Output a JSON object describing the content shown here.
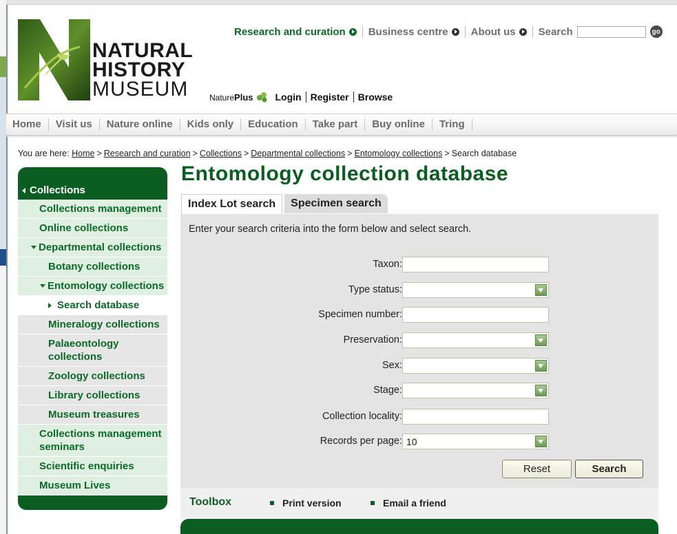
{
  "logo": {
    "line1": "NATURAL",
    "line2": "HISTORY",
    "line3": "MUSEUM"
  },
  "utilnav": {
    "items": [
      "Research and curation",
      "Business centre",
      "About us"
    ],
    "search_label": "Search",
    "search_placeholder": "",
    "go_label": "go"
  },
  "natureplus": {
    "brand_prefix": "Nature",
    "brand_bold": "Plus",
    "login": "Login",
    "register": "Register",
    "browse": "Browse"
  },
  "mainnav": [
    "Home",
    "Visit us",
    "Nature online",
    "Kids only",
    "Education",
    "Take part",
    "Buy online",
    "Tring"
  ],
  "breadcrumb": {
    "prefix": "You are here:",
    "links": [
      "Home",
      "Research and curation",
      "Collections",
      "Departmental collections",
      "Entomology collections"
    ],
    "current": "Search database",
    "separator": ">"
  },
  "sidebar": {
    "heading": "Collections",
    "items": [
      "Collections management",
      "Online collections",
      "Departmental collections",
      "Botany collections",
      "Entomology collections",
      "Search database",
      "Mineralogy collections",
      "Palaeontology collections",
      "Zoology collections",
      "Library collections",
      "Museum treasures",
      "Collections management seminars",
      "Scientific enquiries",
      "Museum Lives"
    ]
  },
  "page_title": "Entomology collection database",
  "tabs": [
    "Index Lot search",
    "Specimen search"
  ],
  "form": {
    "intro": "Enter your search criteria into the form below and select search.",
    "fields": [
      {
        "label": "Taxon:",
        "value": ""
      },
      {
        "label": "Type status:",
        "value": ""
      },
      {
        "label": "Specimen number:",
        "value": ""
      },
      {
        "label": "Preservation:",
        "value": ""
      },
      {
        "label": "Sex:",
        "value": ""
      },
      {
        "label": "Stage:",
        "value": ""
      },
      {
        "label": "Collection locality:",
        "value": ""
      },
      {
        "label": "Records per page:",
        "value": "10"
      }
    ],
    "reset_label": "Reset",
    "search_label": "Search"
  },
  "toolbox": {
    "title": "Toolbox",
    "print": "Print version",
    "email": "Email a friend"
  },
  "colors": {
    "brand_green": "#0c5d22",
    "link_green": "#0c6a28",
    "sidebar_bg": "#dff0e3"
  }
}
